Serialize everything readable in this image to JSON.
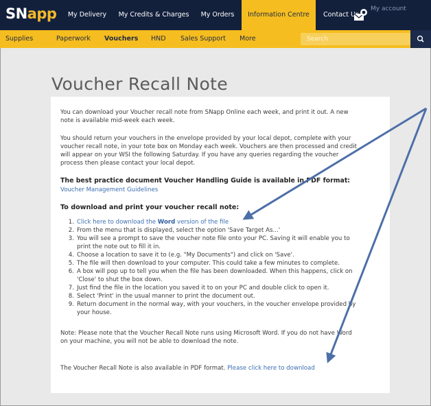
{
  "brand": {
    "logo_sn": "SN",
    "logo_app": "app"
  },
  "top_nav": [
    {
      "label": "My Delivery"
    },
    {
      "label": "My Credits & Charges"
    },
    {
      "label": "My Orders"
    },
    {
      "label": "Information Centre",
      "active": true
    },
    {
      "label": "Contact Us"
    }
  ],
  "account": {
    "label": "My account"
  },
  "sub_nav": [
    {
      "label": "Supplies"
    },
    {
      "label": "Paperwork"
    },
    {
      "label": "Vouchers",
      "active": true
    },
    {
      "label": "HND"
    },
    {
      "label": "Sales Support"
    },
    {
      "label": "More"
    }
  ],
  "search": {
    "placeholder": "Search"
  },
  "page": {
    "title": "Voucher Recall Note",
    "intro_1a": "You can download your Voucher recall note from SNapp Online each week, and print it out. A new",
    "intro_1b": "note is available mid-week each week.",
    "intro_2a": "You should return your vouchers in the envelope provided by your local depot, complete with your",
    "intro_2b": "voucher recall note, in your tote box on Monday each week. Vouchers are then processed and credit",
    "intro_2c": "will appear on your WSI the following Saturday. If you have any queries regarding the voucher",
    "intro_2d": "process then please contact your local depot.",
    "best_practice": "The best practice document Voucher Handling Guide is available in PDF format:",
    "guidelines_link": "Voucher Management Guidelines",
    "download_heading": "To download and print your voucher recall note:",
    "step1_pre": "Click here to download the ",
    "step1_bold": "Word",
    "step1_post": " version of the file",
    "step2": "From the menu that is displayed, select the option 'Save Target As...'",
    "step3a": "You will see a prompt to save the voucher note file onto your PC. Saving it will enable you to",
    "step3b": "print the note out to fill it in.",
    "step4": "Choose a location to save it to (e.g. \"My Documents\") and click on 'Save'.",
    "step5": "The file will then download to your computer. This could take a few minutes to complete.",
    "step6a": "A box will pop up to tell you when the file has been downloaded. When this happens, click on",
    "step6b": "'Close' to shut the box down.",
    "step7": "Just find the file in the location you saved it to on your PC and double click to open it.",
    "step8": "Select 'Print' in the usual manner to print the document out.",
    "step9a": "Return document in the normal way, with your vouchers, in the voucher envelope provided by",
    "step9b": "your house.",
    "note_a": "Note: Please note that the Voucher Recall Note runs using Microsoft Word. If you do not have Word",
    "note_b": "on your machine, you will not be able to download the note.",
    "pdf_pre": "The Voucher Recall Note is also available in PDF format. ",
    "pdf_link": "Please click here to download",
    "step_numbers": [
      "1.",
      "2.",
      "3.",
      "4.",
      "5.",
      "6.",
      "7.",
      "8.",
      "9."
    ]
  },
  "colors": {
    "topbar": "#13203c",
    "accent": "#f5bd1f",
    "link": "#3b6fb2",
    "annotation_arrow": "#4d6fa8"
  }
}
